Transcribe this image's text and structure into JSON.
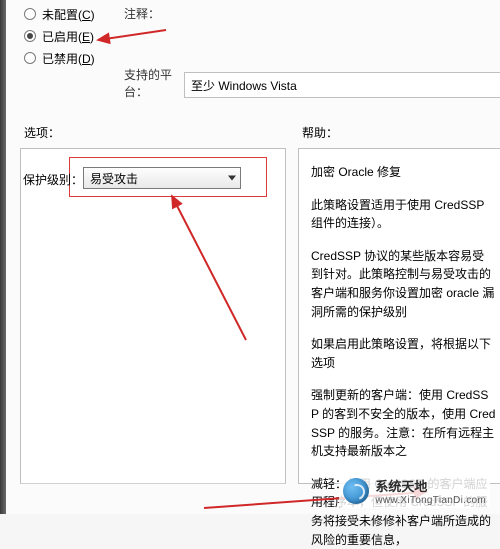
{
  "radios": {
    "unconfig": {
      "label": "未配置(",
      "accel": "C",
      "suffix": ")"
    },
    "enabled": {
      "label": "已启用(",
      "accel": "E",
      "suffix": ")"
    },
    "disabled": {
      "label": "已禁用(",
      "accel": "D",
      "suffix": ")"
    }
  },
  "rows": {
    "note_label": "注释：",
    "platform_label": "支持的平台：",
    "platform_value": "至少 Windows Vista"
  },
  "sections": {
    "options": "选项：",
    "help": "帮助："
  },
  "option": {
    "prot_label": "保护级别：",
    "prot_value": "易受攻击"
  },
  "help": {
    "p1": "加密 Oracle 修复",
    "p2": "此策略设置适用于使用 CredSSP 组件的连接）。",
    "p3": "CredSSP 协议的某些版本容易受到针对。此策略控制与易受攻击的客户端和服务你设置加密 oracle 漏洞所需的保护级别",
    "p4": "如果启用此策略设置，将根据以下选项",
    "p5": "强制更新的客户端：使用 CredSSP 的客到不安全的版本，使用 CredSSP 的服务。注意：在所有远程主机支持最新版本之",
    "p6": "减轻：使用 CredSSP 的客户端应用程序本，但使用 CredSSP 的服务将接受未修修补客户端所造成的风险的重要信息，"
  },
  "watermark": {
    "name": "系统天地",
    "url": "www.XiTongTianDi.com"
  }
}
